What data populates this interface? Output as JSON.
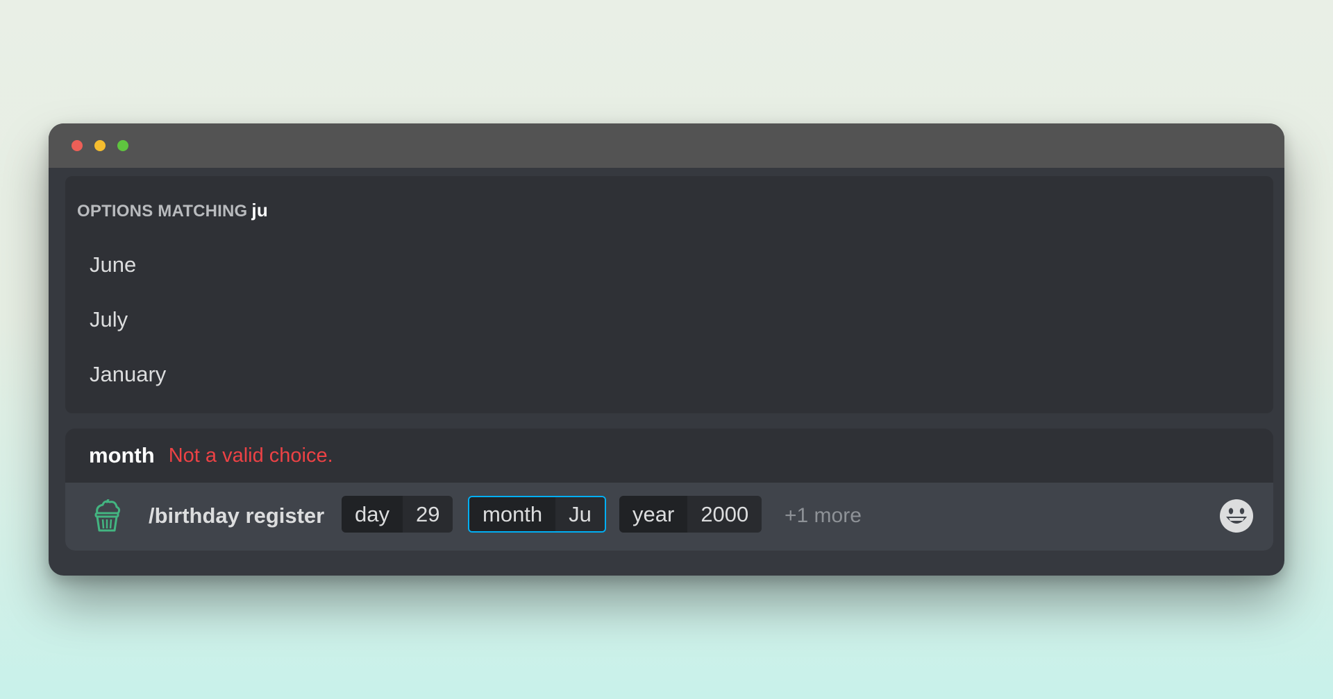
{
  "autocomplete": {
    "header_prefix": "OPTIONS MATCHING",
    "query": "ju",
    "options": [
      {
        "label": "June"
      },
      {
        "label": "July"
      },
      {
        "label": "January"
      }
    ]
  },
  "validation": {
    "option": "month",
    "message": "Not a valid choice."
  },
  "command": {
    "icon": "cupcake-icon",
    "name": "/birthday register",
    "params": [
      {
        "name": "day",
        "value": "29",
        "active": false
      },
      {
        "name": "month",
        "value": "Ju",
        "active": true
      },
      {
        "name": "year",
        "value": "2000",
        "active": false
      }
    ],
    "more_label": "+1 more"
  },
  "emoji_button": {
    "icon": "smiley-face-icon"
  },
  "colors": {
    "error": "#ed4245",
    "focus_border": "#00aff4",
    "icon_accent": "#43b581"
  }
}
